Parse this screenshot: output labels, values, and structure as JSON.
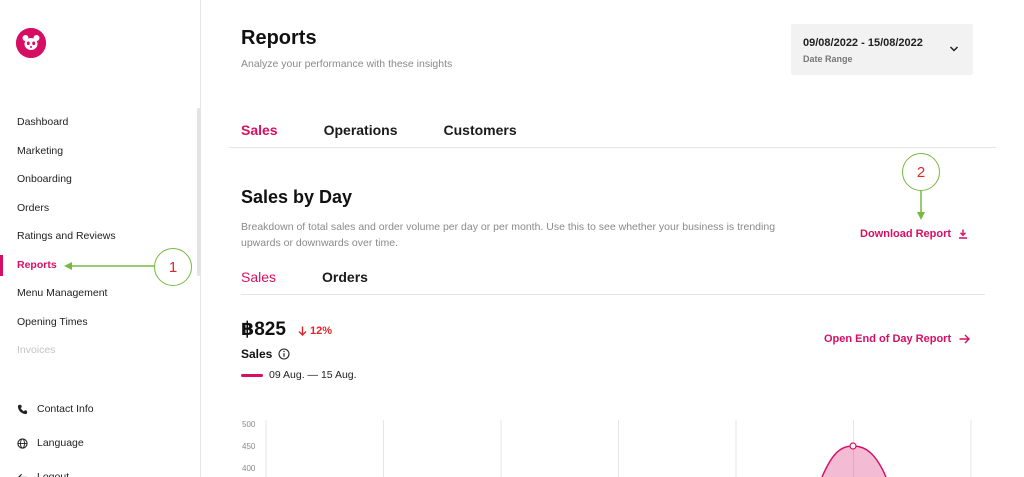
{
  "sidebar": {
    "items": [
      {
        "label": "Dashboard",
        "state": "normal"
      },
      {
        "label": "Marketing",
        "state": "normal"
      },
      {
        "label": "Onboarding",
        "state": "normal"
      },
      {
        "label": "Orders",
        "state": "normal"
      },
      {
        "label": "Ratings and Reviews",
        "state": "normal"
      },
      {
        "label": "Reports",
        "state": "active"
      },
      {
        "label": "Menu Management",
        "state": "normal"
      },
      {
        "label": "Opening Times",
        "state": "normal"
      },
      {
        "label": "Invoices",
        "state": "disabled"
      }
    ],
    "bottom": [
      {
        "label": "Contact Info",
        "icon": "phone-icon"
      },
      {
        "label": "Language",
        "icon": "globe-icon"
      },
      {
        "label": "Logout",
        "icon": "arrow-left-icon"
      }
    ]
  },
  "header": {
    "title": "Reports",
    "subtitle": "Analyze your performance with these insights",
    "date_range": {
      "value": "09/08/2022 - 15/08/2022",
      "label": "Date Range"
    }
  },
  "tabs": [
    {
      "label": "Sales",
      "active": true
    },
    {
      "label": "Operations",
      "active": false
    },
    {
      "label": "Customers",
      "active": false
    }
  ],
  "section": {
    "title": "Sales by Day",
    "description": "Breakdown of total sales and order volume per day or per month. Use this to see whether your business is trending upwards or downwards over time.",
    "download_label": "Download Report",
    "sub_tabs": [
      {
        "label": "Sales",
        "active": true
      },
      {
        "label": "Orders",
        "active": false
      }
    ],
    "metric": {
      "value": "฿825",
      "change": "12%",
      "label": "Sales",
      "legend": "09 Aug. — 15 Aug."
    },
    "eod_label": "Open End of Day Report"
  },
  "colors": {
    "brand": "#d70f64",
    "negative": "#e0262b",
    "annotation": "#79b943"
  },
  "annotations": [
    "1",
    "2"
  ],
  "chart_data": {
    "type": "area",
    "y_ticks": [
      500,
      450,
      400
    ],
    "peak_value": 450
  }
}
